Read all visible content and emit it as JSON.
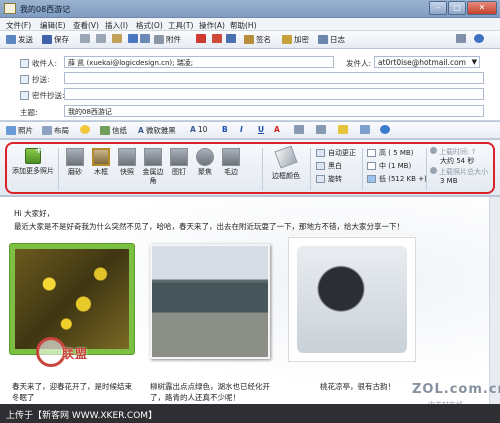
{
  "window": {
    "title": "我的08西游记"
  },
  "menu": [
    "文件(F)",
    "编辑(E)",
    "查看(V)",
    "插入(I)",
    "格式(O)",
    "工具(T)",
    "操作(A)",
    "帮助(H)"
  ],
  "toolbar": {
    "send": "发送",
    "save": "保存",
    "attach": "附件",
    "sign": "签名",
    "encrypt": "加密",
    "log": "日志"
  },
  "header": {
    "to_label": "收件人:",
    "to_value": "薛 凯 (xuekai@logicdesign.cn);  瑞凌;",
    "cc_label": "抄送:",
    "bcc_label": "密件抄送:",
    "subject_label": "主题:",
    "subject_value": "我的08西游记",
    "from_label": "发件人:",
    "from_value": "at0rt0ise@hotmail.com"
  },
  "format": {
    "photos": "照片",
    "layout": "布局",
    "stationery": "信纸",
    "font": "微软雅黑",
    "size": "10",
    "bold": "B",
    "italic": "I",
    "underline": "U",
    "color": "A"
  },
  "photo_tools": {
    "add": "添加更多照片",
    "effects": [
      {
        "label": "磨砂"
      },
      {
        "label": "木框"
      },
      {
        "label": "快照"
      },
      {
        "label": "金属边角"
      },
      {
        "label": "图钉"
      },
      {
        "label": "聚焦"
      },
      {
        "label": "毛边"
      }
    ],
    "border_color": "边框颜色",
    "adjust": [
      "自动更正",
      "黑白",
      "旋转"
    ],
    "sizes": [
      "高 ( 5 MB)",
      "中 (1 MB)",
      "低 (512 KB +)"
    ],
    "upload_time_label": "上载时间: ?",
    "upload_time_value": "大约 54 秒",
    "upload_size_label": "上载照片总大小",
    "upload_size_value": "3 MB"
  },
  "body": {
    "greeting": "Hi 大家好，",
    "intro": "最近大家是不是好奇我为什么突然不见了，哈哈，春天来了，出去在附近玩耍了一下，那地方不错，给大家分享一下！",
    "captions": [
      "春天来了，迎春花开了，是时候结束冬眠了",
      "柳树露出点点绿色，湖水也已经化开了，路青的人还真不少呢！",
      "桃花凉亭，很有古韵！"
    ]
  },
  "watermark": {
    "brand": "联盟",
    "zol": "ZOL.com.cn",
    "zol_sub": "中关村在线"
  },
  "footer": "上传于【新客网 WWW.XKER.COM】"
}
